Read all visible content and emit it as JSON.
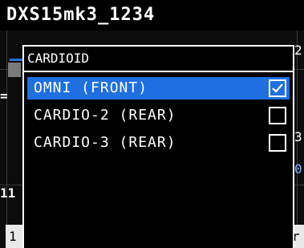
{
  "title": "DXS15mk3_1234",
  "background": {
    "left_number": "11",
    "bottom_box": "1",
    "right_fragments": [
      "2",
      "3",
      "0",
      "r"
    ]
  },
  "dialog": {
    "title": "CARDIOID",
    "options": [
      {
        "label": "OMNI (FRONT)",
        "checked": true
      },
      {
        "label": "CARDIO-2 (REAR)",
        "checked": false
      },
      {
        "label": "CARDIO-3 (REAR)",
        "checked": false
      }
    ]
  },
  "colors": {
    "selection": "#1f6fe0",
    "accent_blue": "#2a6fdb",
    "border": "#ffffff",
    "background": "#000000"
  }
}
